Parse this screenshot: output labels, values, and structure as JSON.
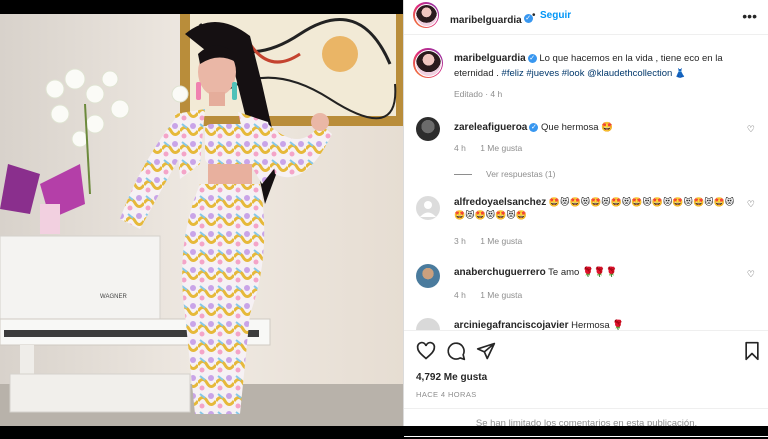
{
  "post": {
    "username": "maribelguardia",
    "follow_label": "Seguir",
    "more_label": "•••",
    "caption_text": "Lo que hacemos en la vida , tiene eco en la eternidad .",
    "caption_tags": "#feliz #jueves #look @klaudethcollection",
    "caption_emoji": "👗",
    "edited_meta": "Editado · 4 h"
  },
  "photo": {
    "brand_label": "WAGNER"
  },
  "comments": [
    {
      "username": "zareleafigueroa",
      "verified": true,
      "text": "Que hermosa 🤩",
      "time": "4 h",
      "likes": "1 Me gusta",
      "replies_label": "Ver respuestas (1)"
    },
    {
      "username": "alfredoyaelsanchez",
      "verified": false,
      "text": "🤩😻🤩😻🤩😻🤩😻🤩😻🤩😻🤩😻🤩😻🤩😻🤩😻🤩😻🤩😻🤩",
      "time": "3 h",
      "likes": "1 Me gusta"
    },
    {
      "username": "anaberchuguerrero",
      "verified": false,
      "text": "Te amo 🌹🌹🌹",
      "time": "4 h",
      "likes": "1 Me gusta"
    },
    {
      "username": "arciniegafranciscojavier",
      "verified": false,
      "text": "Hermosa 🌹"
    }
  ],
  "actions": {
    "likes": "4,792 Me gusta",
    "time_ago": "HACE 4 HORAS",
    "comments_limited": "Se han limitado los comentarios en esta publicación."
  },
  "icons": {
    "like": "heart-icon",
    "comment": "comment-icon",
    "share": "share-icon",
    "save": "bookmark-icon",
    "verified": "verified-badge-icon"
  },
  "colors": {
    "link_blue": "#0095f6",
    "tag_blue": "#00376b",
    "meta_gray": "#8e8e8e",
    "verified_blue": "#3897f0"
  }
}
